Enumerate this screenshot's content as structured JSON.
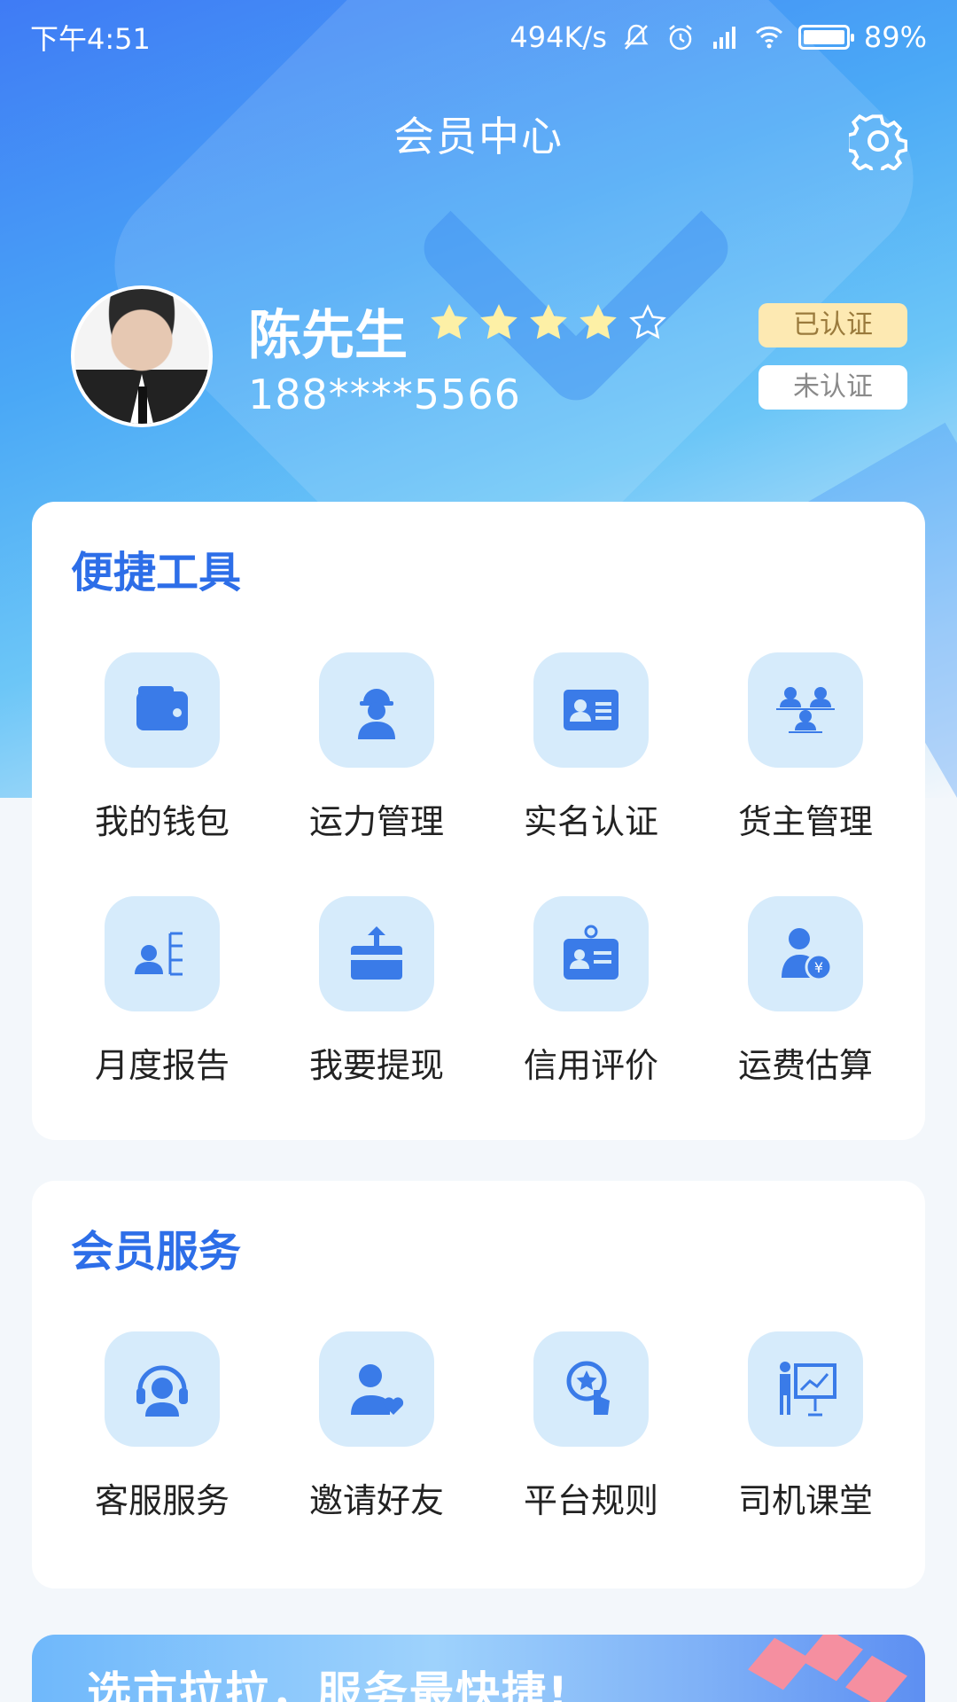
{
  "status_bar": {
    "time": "下午4:51",
    "network_speed": "494K/s",
    "battery_text": "89%",
    "battery_level": 0.89
  },
  "header": {
    "title": "会员中心",
    "settings_icon": "gear-icon"
  },
  "profile": {
    "name": "陈先生",
    "phone": "188****5566",
    "rating": 4,
    "rating_max": 5,
    "badges": {
      "verified": "已认证",
      "unverified": "未认证"
    }
  },
  "tools": {
    "title": "便捷工具",
    "items": [
      {
        "label": "我的钱包",
        "icon": "wallet-icon"
      },
      {
        "label": "运力管理",
        "icon": "worker-icon"
      },
      {
        "label": "实名认证",
        "icon": "id-card-icon"
      },
      {
        "label": "货主管理",
        "icon": "team-icon"
      },
      {
        "label": "月度报告",
        "icon": "report-icon"
      },
      {
        "label": "我要提现",
        "icon": "withdraw-icon"
      },
      {
        "label": "信用评价",
        "icon": "badge-icon"
      },
      {
        "label": "运费估算",
        "icon": "freight-fee-icon"
      }
    ]
  },
  "services": {
    "title": "会员服务",
    "items": [
      {
        "label": "客服服务",
        "icon": "headset-icon"
      },
      {
        "label": "邀请好友",
        "icon": "invite-icon"
      },
      {
        "label": "平台规则",
        "icon": "rules-icon"
      },
      {
        "label": "司机课堂",
        "icon": "classroom-icon"
      }
    ]
  },
  "banner": {
    "text": "选市拉拉，服务最快捷!"
  },
  "colors": {
    "accent": "#2d6ee8",
    "icon_bg": "#d6ebfb",
    "icon_fg": "#3a7be8",
    "star": "#fdf0a6"
  }
}
